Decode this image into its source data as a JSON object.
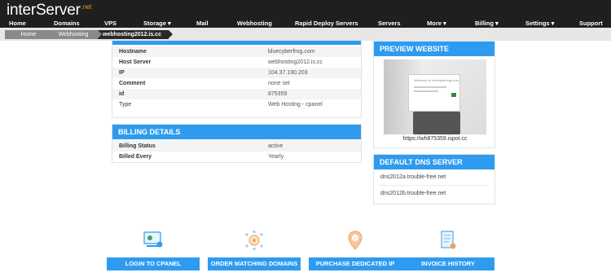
{
  "brand": {
    "logo_main": "interServer",
    "logo_suffix": ".net"
  },
  "nav": {
    "items": [
      {
        "label": "Home"
      },
      {
        "label": "Domains"
      },
      {
        "label": "VPS"
      },
      {
        "label": "Storage ▾"
      },
      {
        "label": "Mail"
      },
      {
        "label": "Webhosting"
      },
      {
        "label": "Rapid Deploy Servers"
      },
      {
        "label": "Servers"
      },
      {
        "label": "More ▾"
      },
      {
        "label": "Billing ▾"
      },
      {
        "label": "Settings ▾"
      },
      {
        "label": "Support"
      }
    ]
  },
  "breadcrumb": [
    "Home",
    "Webhosting",
    "webhosting2012.is.cc"
  ],
  "info_table": {
    "rows": [
      {
        "key": "Hostname",
        "value": "bluecyberfrog.com"
      },
      {
        "key": "Host Server",
        "value": "webhosting2012.is.cc"
      },
      {
        "key": "IP",
        "value": "104.37.190.203"
      },
      {
        "key": "Comment",
        "value": "none set"
      },
      {
        "key": "id",
        "value": "875359"
      },
      {
        "key": "Type",
        "value": "Web Hosting - cpanel"
      }
    ]
  },
  "billing": {
    "title": "BILLING DETAILS",
    "rows": [
      {
        "key": "Billing Status",
        "value": "active"
      },
      {
        "key": "Billed Every",
        "value": "Yearly"
      }
    ]
  },
  "preview": {
    "title": "PREVIEW WEBSITE",
    "image_text": "Welcome to bluecyberfrog.com",
    "caption": "https://wh875359.ispot.cc"
  },
  "dns": {
    "title": "DEFAULT DNS SERVER",
    "servers": [
      "dns2012a.trouble-free.net",
      "dns2012b.trouble-free.net"
    ]
  },
  "actions": [
    {
      "label": "LOGIN TO CPANEL",
      "icon": "cpanel-login-icon"
    },
    {
      "label": "ORDER MATCHING DOMAINS",
      "icon": "domains-globe-icon"
    },
    {
      "label": "PURCHASE DEDICATED IP",
      "icon": "dedicated-ip-icon"
    },
    {
      "label": "INVOICE HISTORY",
      "icon": "invoice-icon"
    }
  ],
  "colors": {
    "accent": "#2e9bf0",
    "topbar": "#1f1f1f",
    "logo_suffix": "#f7941d"
  }
}
